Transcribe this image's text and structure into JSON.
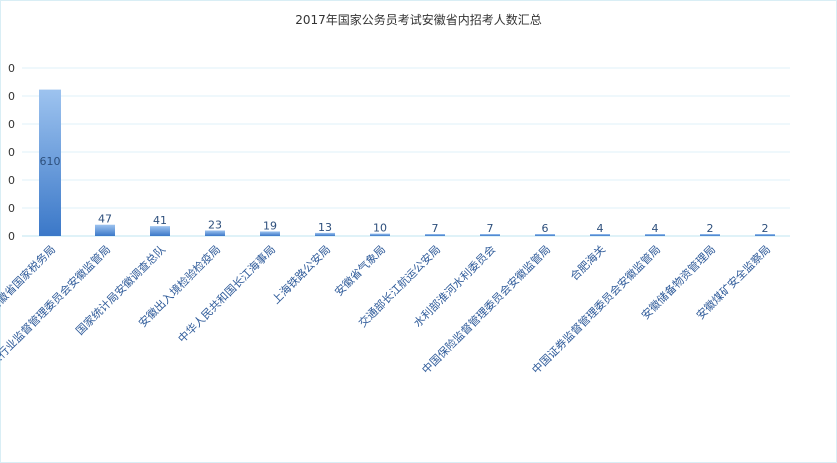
{
  "chart_data": {
    "type": "bar",
    "title": "2017年国家公务员考试安徽省内招考人数汇总",
    "xlabel": "",
    "ylabel": "",
    "y_tick_labels": [
      "0",
      "0",
      "0",
      "0",
      "0",
      "0",
      "0"
    ],
    "grid": true,
    "legend": "none",
    "categories": [
      "安徽省国家税务局",
      "中国银行业监督管理委员会安徽监管局",
      "国家统计局安徽调查总队",
      "安徽出入境检验检疫局",
      "中华人民共和国长江海事局",
      "上海铁路公安局",
      "安徽省气象局",
      "交通部长江航运公安局",
      "水利部淮河水利委员会",
      "中国保险监督管理委员会安徽监管局",
      "合肥海关",
      "中国证券监督管理委员会安徽监管局",
      "安徽储备物资管理局",
      "安徽煤矿安全监察局"
    ],
    "values": [
      610,
      47,
      41,
      23,
      19,
      13,
      10,
      7,
      7,
      6,
      4,
      4,
      2,
      2
    ],
    "colors": {
      "bar_top": "#9dc3ef",
      "bar_bottom": "#3b78c8",
      "grid": "#dff2f8",
      "axis": "#bfe5f0"
    }
  }
}
